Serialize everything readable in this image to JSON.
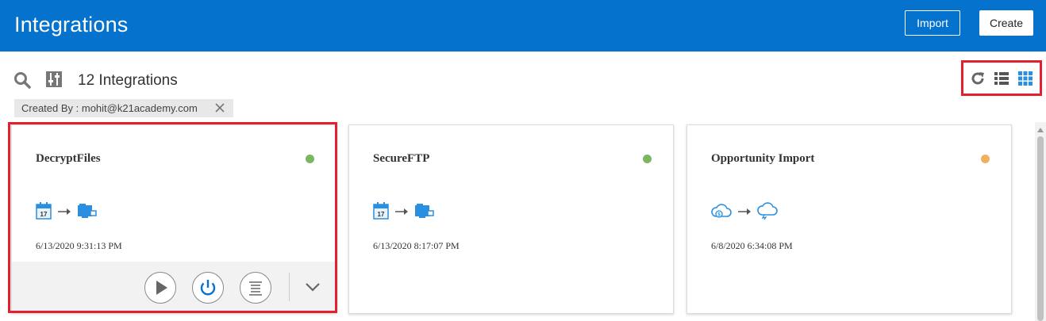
{
  "header": {
    "title": "Integrations",
    "import_label": "Import",
    "create_label": "Create",
    "bg_color": "#0572ce"
  },
  "toolbar": {
    "count_label": "12 Integrations",
    "search_icon": "search-icon",
    "filter_icon": "filter-settings-icon",
    "view_icons": [
      "refresh-icon",
      "list-view-icon",
      "grid-view-icon"
    ],
    "active_view": "grid"
  },
  "filter_chip": {
    "label": "Created By : mohit@k21academy.com"
  },
  "cards": [
    {
      "title": "DecryptFiles",
      "status_color": "#7bb661",
      "source_icon": "calendar-icon",
      "source_text": "17",
      "target_icon": "ftp-adapter-icon",
      "date": "6/13/2020 9:31:13 PM",
      "expanded": true
    },
    {
      "title": "SecureFTP",
      "status_color": "#7bb661",
      "source_icon": "calendar-icon",
      "source_text": "17",
      "target_icon": "ftp-adapter-icon",
      "date": "6/13/2020 8:17:07 PM",
      "expanded": false
    },
    {
      "title": "Opportunity Import",
      "status_color": "#f0b060",
      "source_icon": "cloud-service-icon",
      "target_icon": "cloud-icon",
      "date": "6/8/2020 6:34:08 PM",
      "expanded": false
    }
  ],
  "card_actions": [
    "run-icon",
    "power-icon",
    "menu-list-icon",
    "chevron-down-icon"
  ],
  "colors": {
    "highlight": "#e5202e",
    "accent": "#0572ce"
  }
}
